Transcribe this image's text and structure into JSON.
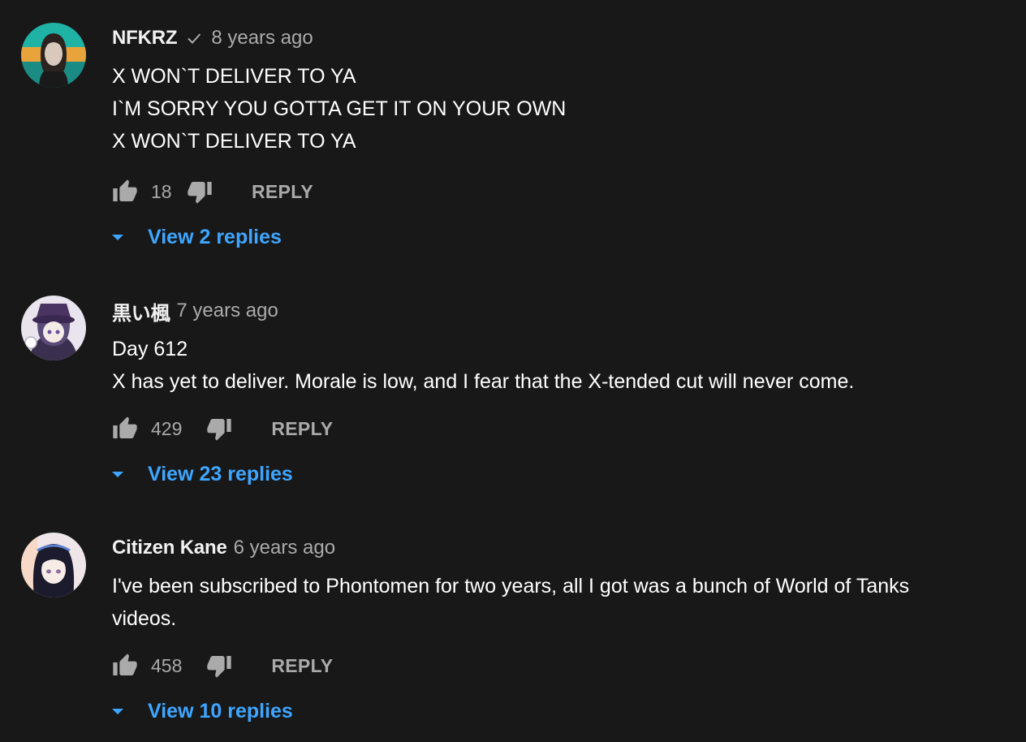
{
  "colors": {
    "background": "#181818",
    "text": "#ffffff",
    "secondary_text": "#aaaaaa",
    "link": "#3ea6ff"
  },
  "comments": [
    {
      "author": "NFKRZ",
      "verified": true,
      "time": "8 years ago",
      "lines": [
        "X WON`T DELIVER TO YA",
        "I`M SORRY YOU GOTTA GET IT ON YOUR OWN",
        "X WON`T DELIVER TO YA"
      ],
      "likes": "18",
      "reply_label": "REPLY",
      "view_replies": "View 2 replies",
      "like_icon": "thumbs-up-icon",
      "dislike_icon": "thumbs-down-icon"
    },
    {
      "author": "黒い楓",
      "verified": false,
      "time": "7 years ago",
      "lines": [
        "Day 612",
        "X has yet to deliver. Morale is low, and I fear that the X-tended cut will never come."
      ],
      "likes": "429",
      "reply_label": "REPLY",
      "view_replies": "View 23 replies"
    },
    {
      "author": "Citizen Kane",
      "verified": false,
      "time": "6 years ago",
      "lines": [
        "I've been subscribed to Phontomen for two years, all I got was a bunch of World of Tanks",
        "videos."
      ],
      "likes": "458",
      "reply_label": "REPLY",
      "view_replies": "View 10 replies"
    }
  ]
}
